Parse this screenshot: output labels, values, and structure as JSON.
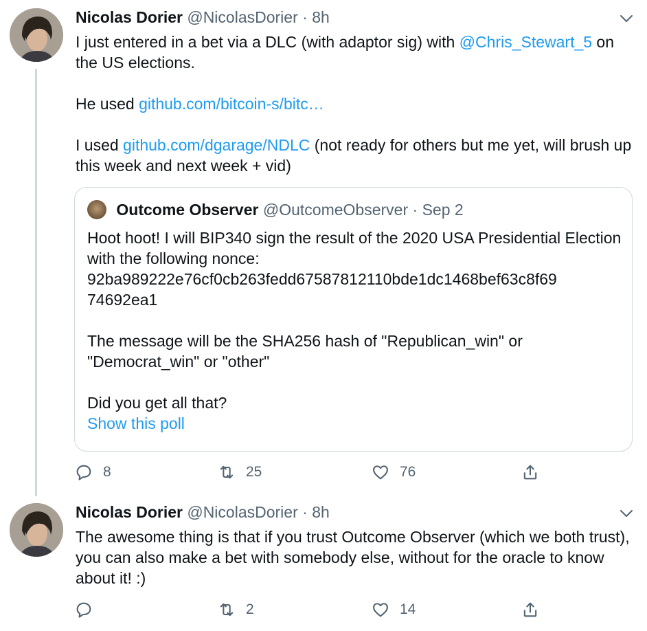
{
  "tweets": [
    {
      "author": {
        "name": "Nicolas Dorier",
        "handle": "@NicolasDorier",
        "time": "8h",
        "separator": "·"
      },
      "paragraphs": [
        [
          {
            "text": "I just entered in a bet via a DLC (with adaptor sig) with "
          },
          {
            "text": "@Chris_Stewart_5",
            "link": true
          },
          {
            "text": " on the US elections."
          }
        ],
        [
          {
            "text": "He used "
          },
          {
            "text": "github.com/bitcoin-s/bitc…",
            "link": true
          }
        ],
        [
          {
            "text": "I used "
          },
          {
            "text": "github.com/dgarage/NDLC",
            "link": true
          },
          {
            "text": " (not ready for others but me yet, will brush up this week and next week + vid)"
          }
        ]
      ],
      "quote": {
        "name": "Outcome Observer",
        "handle": "@OutcomeObserver",
        "separator": "·",
        "time": "Sep 2",
        "lines": [
          "Hoot hoot! I will BIP340 sign the result of the 2020 USA Presidential Election with the following nonce:",
          "92ba989222e76cf0cb263fedd67587812110bde1dc1468bef63c8f69",
          "74692ea1",
          "",
          "The message will be the SHA256 hash of \"Republican_win\" or \"Democrat_win\" or \"other\"",
          "",
          "Did you get all that?"
        ],
        "show_poll": "Show this poll"
      },
      "actions": {
        "reply_count": "8",
        "retweet_count": "25",
        "like_count": "76"
      }
    },
    {
      "author": {
        "name": "Nicolas Dorier",
        "handle": "@NicolasDorier",
        "time": "8h",
        "separator": "·"
      },
      "paragraphs": [
        [
          {
            "text": "The awesome thing is that if you trust Outcome Observer (which we both trust), you can also make a bet with somebody else, without for the oracle to know about it! :)"
          }
        ]
      ],
      "actions": {
        "reply_count": "",
        "retweet_count": "2",
        "like_count": "14"
      }
    }
  ],
  "icons": [
    "reply-icon",
    "retweet-icon",
    "like-icon",
    "share-icon",
    "chevron-down-icon"
  ],
  "colors": {
    "link": "#1d9bf0",
    "secondary": "#536471",
    "border": "#cfd9de",
    "text": "#0f1419"
  }
}
